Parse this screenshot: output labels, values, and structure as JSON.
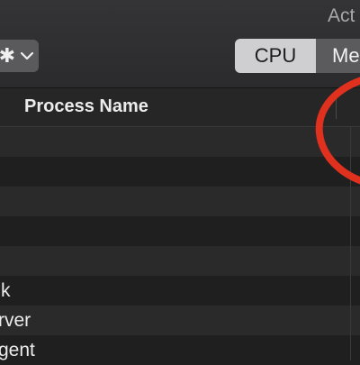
{
  "window": {
    "title": "Act"
  },
  "toolbar": {
    "gear_icon": "gear-icon",
    "chevron_icon": "chevron-down-icon",
    "tabs": [
      {
        "label": "CPU",
        "selected": true
      },
      {
        "label": "Me",
        "selected": false
      }
    ]
  },
  "table": {
    "header": {
      "process_name": "Process Name"
    },
    "rows": [
      {
        "name": ""
      },
      {
        "name": ""
      },
      {
        "name": ""
      },
      {
        "name": ""
      },
      {
        "name": ""
      },
      {
        "name": "k"
      },
      {
        "name": "rver"
      },
      {
        "name": "gent"
      }
    ]
  },
  "annotation": {
    "color": "#e0301e",
    "shape": "circle"
  }
}
